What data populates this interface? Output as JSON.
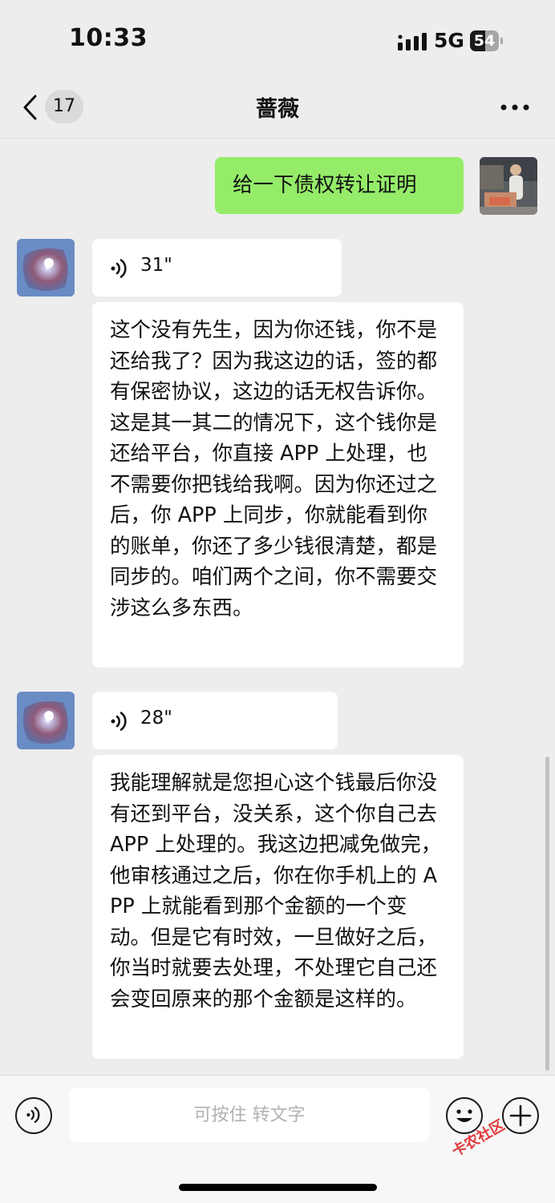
{
  "status_bar": {
    "time": "10:33",
    "network": "5G",
    "battery": "54",
    "battery_level": 0.54
  },
  "nav": {
    "unread_count": "17",
    "title": "蔷薇"
  },
  "messages": {
    "m1": {
      "text": "给一下债权转让证明"
    },
    "m2": {
      "duration": "31\""
    },
    "m3": {
      "text": "这个没有先生，因为你还钱，你不是还给我了？因为我这边的话，签的都有保密协议，这边的话无权告诉你。这是其一其二的情况下，这个钱你是还给平台，你直接 APP 上处理，也不需要你把钱给我啊。因为你还过之后，你 APP 上同步，你就能看到你的账单，你还了多少钱很清楚，都是同步的。咱们两个之间，你不需要交涉这么多东西。"
    },
    "m4": {
      "duration": "28\""
    },
    "m5": {
      "text": "我能理解就是您担心这个钱最后你没有还到平台，没关系，这个你自己去 APP 上处理的。我这边把减免做完，他审核通过之后，你在你手机上的 APP 上就能看到那个金额的一个变动。但是它有时效，一旦做好之后，你当时就要去处理，不处理它自己还会变回原来的那个金额是这样的。"
    }
  },
  "input": {
    "placeholder": "可按住 转文字"
  },
  "watermark": {
    "text": "卡农社区"
  },
  "colors": {
    "me_bubble": "#95ec69",
    "background": "#ededed"
  }
}
